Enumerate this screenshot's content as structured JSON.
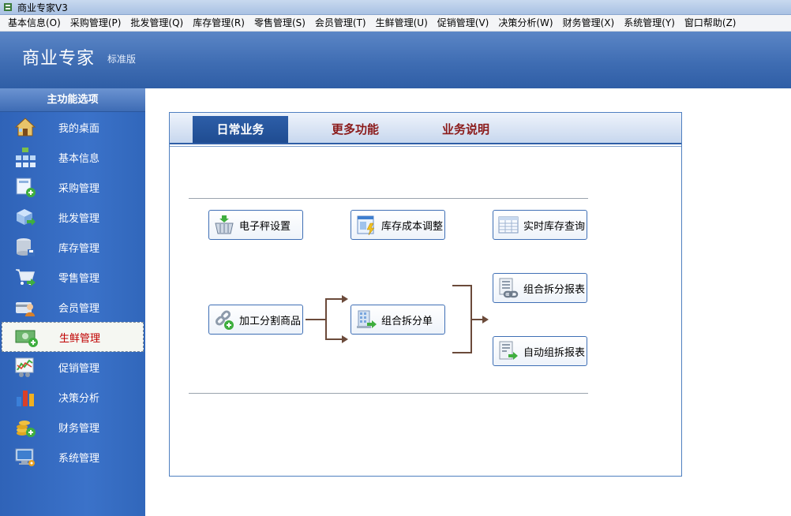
{
  "window": {
    "title": "商业专家V3"
  },
  "menu": [
    "基本信息(O)",
    "采购管理(P)",
    "批发管理(Q)",
    "库存管理(R)",
    "零售管理(S)",
    "会员管理(T)",
    "生鲜管理(U)",
    "促销管理(V)",
    "决策分析(W)",
    "财务管理(X)",
    "系统管理(Y)",
    "窗口帮助(Z)"
  ],
  "header": {
    "brand": "商业专家",
    "edition": "标准版"
  },
  "sidebar": {
    "title": "主功能选项",
    "active_index": 7,
    "items": [
      {
        "label": "我的桌面",
        "icon": "home-icon"
      },
      {
        "label": "基本信息",
        "icon": "org-chart-icon"
      },
      {
        "label": "采购管理",
        "icon": "purchase-icon"
      },
      {
        "label": "批发管理",
        "icon": "wholesale-icon"
      },
      {
        "label": "库存管理",
        "icon": "database-icon"
      },
      {
        "label": "零售管理",
        "icon": "cart-icon"
      },
      {
        "label": "会员管理",
        "icon": "member-icon"
      },
      {
        "label": "生鲜管理",
        "icon": "cash-icon"
      },
      {
        "label": "促销管理",
        "icon": "chart-line-icon"
      },
      {
        "label": "决策分析",
        "icon": "bar-chart-icon"
      },
      {
        "label": "财务管理",
        "icon": "coins-icon"
      },
      {
        "label": "系统管理",
        "icon": "computer-icon"
      }
    ]
  },
  "tabs": [
    {
      "label": "日常业务",
      "active": true
    },
    {
      "label": "更多功能",
      "active": false
    },
    {
      "label": "业务说明",
      "active": false
    }
  ],
  "functions": {
    "scale_settings": "电子秤设置",
    "cost_adjust": "库存成本调整",
    "realtime_stock": "实时库存查询",
    "process_split": "加工分割商品",
    "combo_split_order": "组合拆分单",
    "combo_split_report": "组合拆分报表",
    "auto_combo_report": "自动组拆报表"
  },
  "colors": {
    "accent": "#2f5ea6",
    "sidebar": "#3466b9",
    "active_text": "#c00000",
    "tab_text": "#8b1a1a",
    "arrow": "#6b4a3a"
  }
}
